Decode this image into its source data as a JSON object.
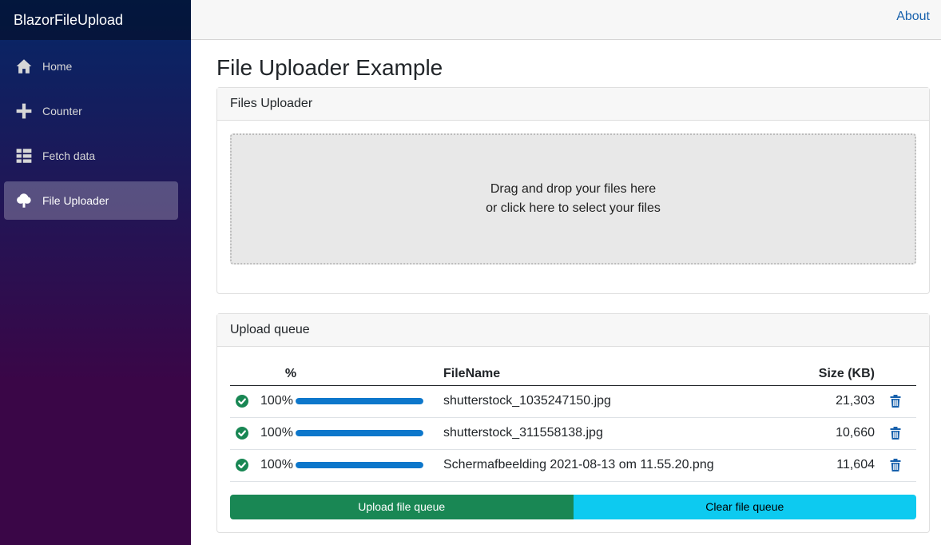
{
  "brand": "BlazorFileUpload",
  "nav": [
    {
      "label": "Home",
      "icon": "home-icon"
    },
    {
      "label": "Counter",
      "icon": "plus-icon"
    },
    {
      "label": "Fetch data",
      "icon": "list-icon"
    },
    {
      "label": "File Uploader",
      "icon": "cloud-upload-icon",
      "active": true
    }
  ],
  "top": {
    "about": "About"
  },
  "page": {
    "title": "File Uploader Example"
  },
  "uploader": {
    "header": "Files Uploader",
    "drop_line1": "Drag and drop your files here",
    "drop_line2": "or click here to select your files"
  },
  "queue": {
    "header": "Upload queue",
    "columns": {
      "percent": "%",
      "filename": "FileName",
      "size": "Size (KB)"
    },
    "rows": [
      {
        "status": "complete",
        "percent": "100%",
        "progress": 1.0,
        "filename": "shutterstock_1035247150.jpg",
        "size": "21,303"
      },
      {
        "status": "complete",
        "percent": "100%",
        "progress": 1.0,
        "filename": "shutterstock_311558138.jpg",
        "size": "10,660"
      },
      {
        "status": "complete",
        "percent": "100%",
        "progress": 1.0,
        "filename": "Schermafbeelding 2021-08-13 om 11.55.20.png",
        "size": "11,604"
      }
    ],
    "upload_button": "Upload file queue",
    "clear_button": "Clear file queue"
  },
  "colors": {
    "accent": "#1861ac",
    "progress": "#0d77cb",
    "success": "#198754",
    "info": "#0dcaf0"
  }
}
